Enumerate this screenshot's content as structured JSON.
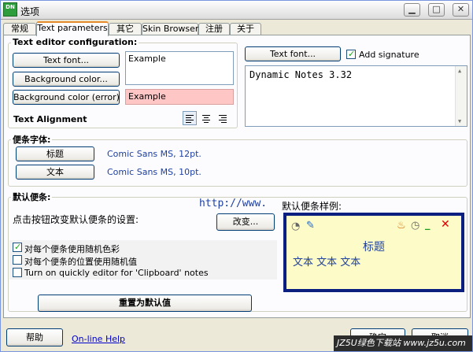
{
  "window": {
    "title": "选项",
    "icon_text": "DN",
    "minimize": "▁",
    "maximize": "□",
    "close": "✕"
  },
  "tabs": [
    {
      "label": "常规"
    },
    {
      "label": "Text parameters"
    },
    {
      "label": "其它"
    },
    {
      "label": "Skin Browser"
    },
    {
      "label": "注册"
    },
    {
      "label": "关于"
    }
  ],
  "text_editor": {
    "group_label": "Text editor configuration:",
    "text_font_button": "Text font...",
    "background_color_button": "Background color...",
    "background_error_button": "Background color (error)...",
    "example_label": "Example",
    "example_error_label": "Example",
    "alignment_label": "Text Alignment",
    "error_bg_color": "#ffc6c6"
  },
  "signature": {
    "text_font_button": "Text font...",
    "add_signature_label": "Add signature",
    "add_signature_checked": true,
    "text": "Dynamic Notes 3.32"
  },
  "note_font": {
    "group_label": "便条字体:",
    "title_button": "标题",
    "title_font": "Comic Sans MS, 12pt.",
    "text_button": "文本",
    "text_font": "Comic Sans MS, 10pt."
  },
  "default_note": {
    "group_label": "默认便条:",
    "url_overlay": "http://www.",
    "sample_label": "默认便条样例:",
    "description": "点击按钮改变默认便条的设置:",
    "change_button": "改变...",
    "checkboxes": [
      {
        "label": "对每个便条使用随机色彩",
        "checked": true
      },
      {
        "label": "对每个便条的位置使用随机值",
        "checked": false
      },
      {
        "label": "Turn on quickly editor for 'Clipboard' notes",
        "checked": false
      }
    ],
    "reset_button": "重置为默认值",
    "preview": {
      "title": "标题",
      "body": "文本 文本 文本",
      "frame_color": "#0a1f80",
      "note_color": "#fdfcc8"
    }
  },
  "footer": {
    "help_button": "帮助",
    "online_help_link": "On-line Help",
    "ok_button": "确定",
    "cancel_button": "取消"
  },
  "watermark": "JZ5U绿色下载站 www.jz5u.com"
}
